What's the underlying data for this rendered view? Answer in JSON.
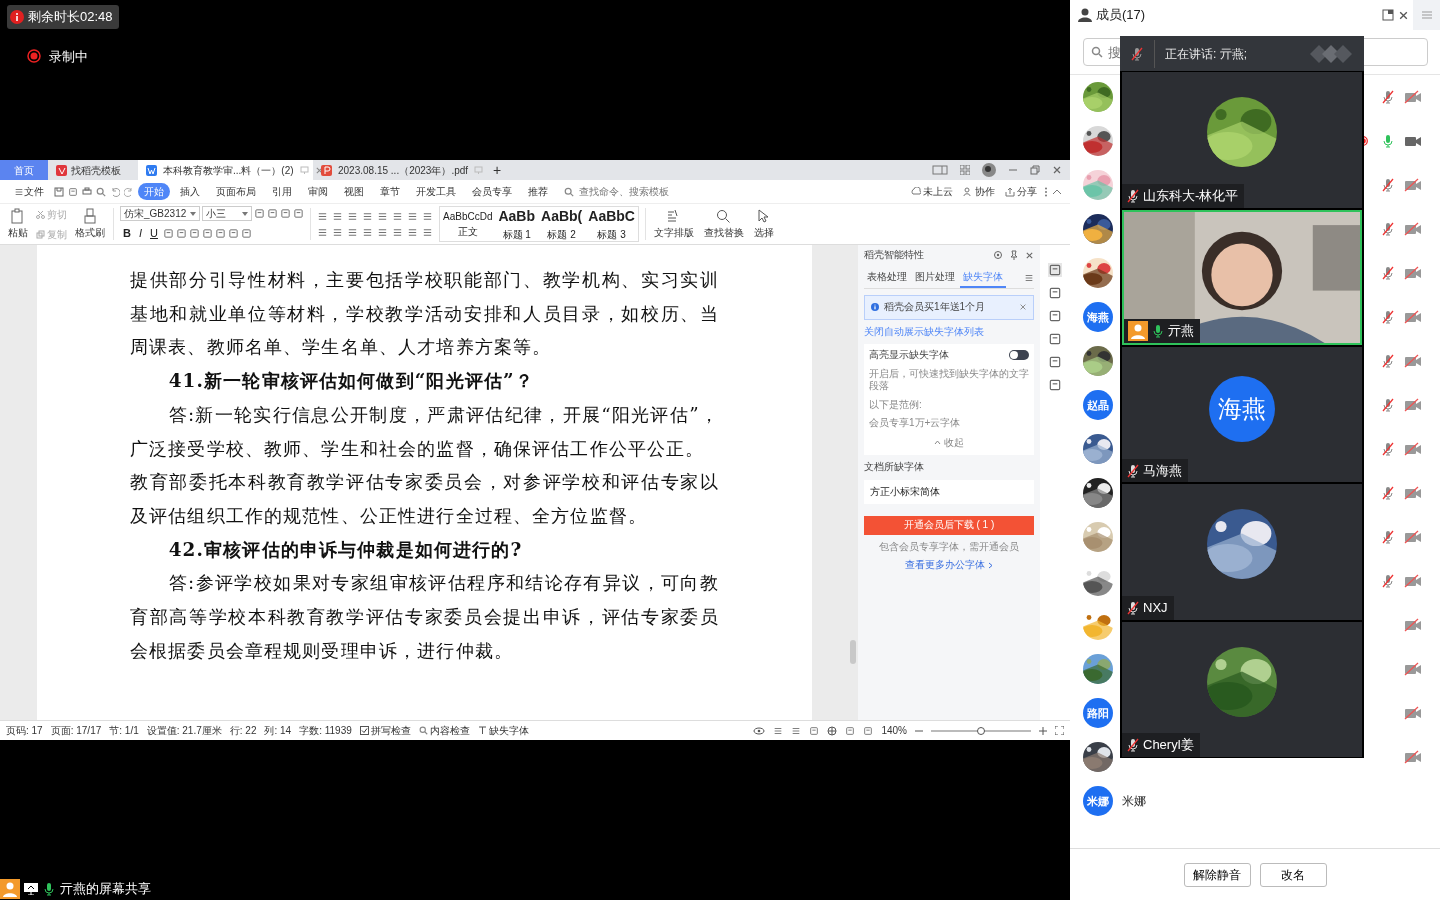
{
  "recording": {
    "timer": "剩余时长02:48",
    "status": "录制中"
  },
  "wps": {
    "tabs": [
      {
        "label": "首页",
        "kind": "home",
        "selected": false
      },
      {
        "label": "找稻壳模板",
        "kind": "docer",
        "selected": false
      },
      {
        "label": "本科教育教学审...料（一）(2)",
        "kind": "word",
        "selected": true
      },
      {
        "label": "2023.08.15 ...（2023年）.pdf",
        "kind": "pdf",
        "selected": false
      }
    ],
    "new_tab": "+",
    "file_menu": "文件",
    "menu_tabs": [
      {
        "label": "开始",
        "selected": true
      },
      {
        "label": "插入",
        "selected": false
      },
      {
        "label": "页面布局",
        "selected": false
      },
      {
        "label": "引用",
        "selected": false
      },
      {
        "label": "审阅",
        "selected": false
      },
      {
        "label": "视图",
        "selected": false
      },
      {
        "label": "章节",
        "selected": false
      },
      {
        "label": "开发工具",
        "selected": false
      },
      {
        "label": "会员专享",
        "selected": false
      },
      {
        "label": "推荐",
        "selected": false
      }
    ],
    "command_search": {
      "placeholder": "查找命令、搜索模板"
    },
    "actions": [
      "未上云",
      "协作",
      "分享"
    ],
    "ribbon": {
      "paste": "粘贴",
      "clipboard": [
        {
          "label": "剪切",
          "disabled": true
        },
        {
          "label": "复制",
          "disabled": true
        }
      ],
      "format_painter": "格式刷",
      "font": "仿宋_GB2312",
      "size": "小三",
      "format_letters": [
        "B",
        "I",
        "U"
      ],
      "styles": [
        {
          "sample": "AaBbCcDd",
          "label": "正文"
        },
        {
          "sample": "AaBb",
          "label": "标题 1"
        },
        {
          "sample": "AaBb(",
          "label": "标题 2"
        },
        {
          "sample": "AaBbC",
          "label": "标题 3"
        }
      ],
      "tools": [
        "文字排版",
        "查找替换",
        "选择"
      ]
    },
    "document": [
      {
        "kind": "continued",
        "text": "提供部分引导性材料，主要包括学校职能部门、教学机构、实习实训基地和就业单位等材料，学校教学活动安排和人员目录，如校历、当周课表、教师名单、学生名单、人才培养方案等。"
      },
      {
        "kind": "heading",
        "text": "41.新一轮审核评估如何做到“阳光评估”？"
      },
      {
        "kind": "body",
        "text": "答:新一轮实行信息公开制度，严肃评估纪律，开展“阳光评估”，广泛接受学校、教师、学生和社会的监督，确保评估工作公平公正。"
      },
      {
        "kind": "continued",
        "text": "教育部委托本科教育教学评估专家委员会，对参评学校和评估专家以及评估组织工作的规范性、公正性进行全过程、全方位监督。"
      },
      {
        "kind": "heading",
        "text": "42.审核评估的申诉与仲裁是如何进行的?"
      },
      {
        "kind": "body",
        "text": "答:参评学校如果对专家组审核评估程序和结论存有异议，可向教育部高等学校本科教育教学评估专家委员会提出申诉，评估专家委员会根据委员会章程规则受理申诉，进行仲裁。"
      }
    ],
    "side_pane": {
      "title": "稻壳智能特性",
      "tabs": [
        {
          "label": "表格处理",
          "selected": false
        },
        {
          "label": "图片处理",
          "selected": false
        },
        {
          "label": "缺失字体",
          "selected": true
        }
      ],
      "notice": "稻壳会员买1年送1个月",
      "close_link": "关闭自动展示缺失字体列表",
      "highlight": {
        "label": "高亮显示缺失字体",
        "on": false,
        "description": "开启后，可快速找到缺失字体的文字段落",
        "example_label": "以下是范例:",
        "example": "会员专享1万+云字体",
        "collapse": "收起"
      },
      "missing_label": "文档所缺字体",
      "missing_font": "方正小标宋简体",
      "download": "开通会员后下载 ( 1 )",
      "note": "包含会员专享字体，需开通会员",
      "more": "查看更多办公字体"
    },
    "status_bar": {
      "items": [
        "页码: 17",
        "页面: 17/17",
        "节: 1/1",
        "设置值: 21.7厘米",
        "行: 22",
        "列: 14",
        "字数: 11939"
      ],
      "spell_check": {
        "label": "拼写检查",
        "checked": true
      },
      "content_check": "内容检查",
      "missing_fonts": "缺失字体",
      "zoom": "140%",
      "zoom_slider": {
        "level": 0.5
      }
    }
  },
  "screen_share": "亓燕的屏幕共享",
  "members": {
    "title": "成员(17)",
    "search": {
      "placeholder": "搜"
    },
    "list": [
      {
        "mic_muted": true,
        "camera_off": true,
        "marker": false
      },
      {
        "mic_muted": false,
        "camera_off": false,
        "marker": true
      },
      {
        "mic_muted": true,
        "camera_off": true,
        "marker": false
      },
      {
        "mic_muted": true,
        "camera_off": true,
        "marker": false
      },
      {
        "mic_muted": true,
        "camera_off": true,
        "marker": false
      },
      {
        "avatar_text": "海燕",
        "mic_muted": true,
        "camera_off": true,
        "marker": false
      },
      {
        "mic_muted": true,
        "camera_off": true,
        "marker": false
      },
      {
        "avatar_text": "赵晶",
        "mic_muted": true,
        "camera_off": true,
        "marker": false
      },
      {
        "mic_muted": true,
        "camera_off": true,
        "marker": false
      },
      {
        "mic_muted": true,
        "camera_off": true,
        "marker": false
      },
      {
        "mic_muted": true,
        "camera_off": true,
        "marker": false
      },
      {
        "mic_muted": true,
        "camera_off": true,
        "marker": false
      },
      {
        "camera_off": true,
        "marker": false
      },
      {
        "camera_off": true,
        "marker": false
      },
      {
        "avatar_text": "路阳",
        "camera_off": true,
        "marker": false
      },
      {
        "camera_off": true,
        "marker": false
      },
      {
        "avatar_text": "米娜",
        "name": "米娜",
        "marker": false
      }
    ],
    "buttons": [
      "解除静音",
      "改名"
    ]
  },
  "video_panel": {
    "speaking": "正在讲话: 亓燕;",
    "tiles": [
      {
        "name": "山东科大-林化平",
        "selected": false,
        "muted": true,
        "host": false
      },
      {
        "name": "亓燕",
        "kind": "video",
        "selected": true,
        "muted": false,
        "host": true
      },
      {
        "name": "马海燕",
        "kind": "text",
        "avatar_text": "海燕",
        "selected": false,
        "muted": true,
        "host": false
      },
      {
        "name": "NXJ",
        "selected": false,
        "muted": true,
        "host": false
      },
      {
        "name": "Cheryl姜",
        "selected": false,
        "muted": true,
        "host": false
      }
    ]
  }
}
